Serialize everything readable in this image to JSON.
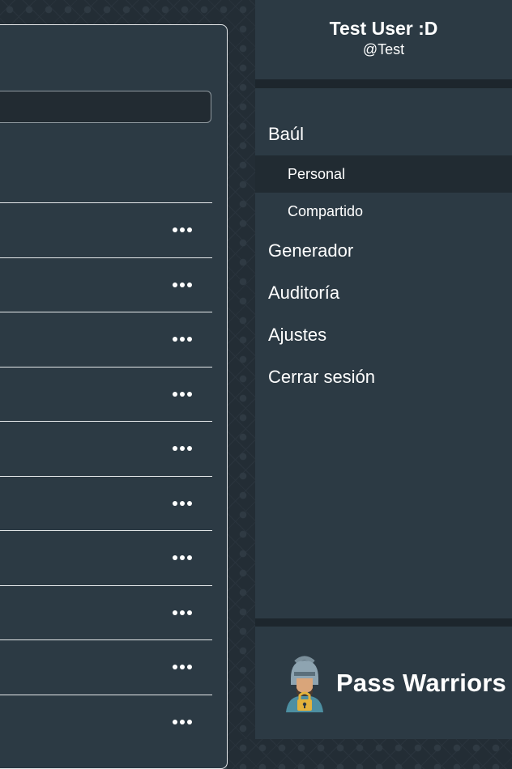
{
  "user": {
    "name": "Test User :D",
    "handle": "@Test"
  },
  "nav": {
    "vault": "Baúl",
    "vault_items": [
      {
        "label": "Personal",
        "active": true
      },
      {
        "label": "Compartido",
        "active": false
      }
    ],
    "generator": "Generador",
    "audit": "Auditoría",
    "settings": "Ajustes",
    "logout": "Cerrar sesión"
  },
  "brand": {
    "name": "Pass Warriors",
    "logo_icon": "warrior-helmet-lock-icon"
  },
  "vault_list": {
    "row_count": 10,
    "row_action_icon": "more-dots-icon"
  },
  "colors": {
    "panel": "#2c3a44",
    "background": "#232d35",
    "active_item": "#212b32"
  }
}
